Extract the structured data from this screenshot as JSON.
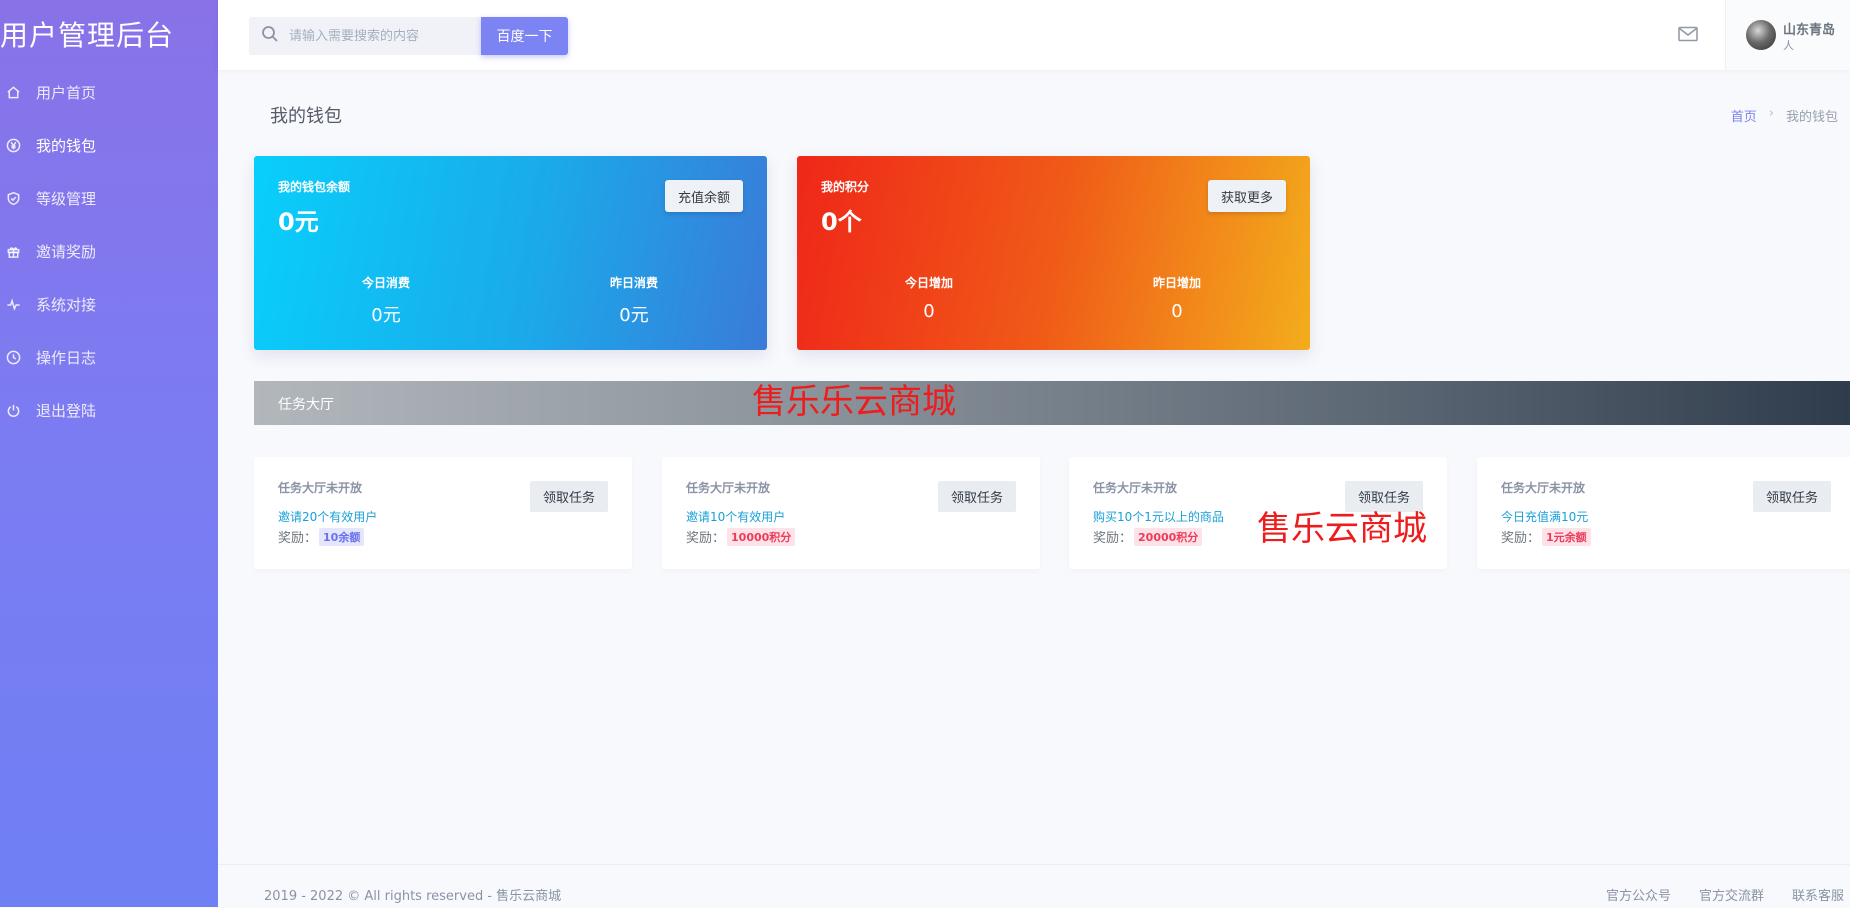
{
  "sidebar": {
    "brand": "用户管理后台",
    "items": [
      {
        "label": "用户首页",
        "icon": "home-icon"
      },
      {
        "label": "我的钱包",
        "icon": "yen-icon"
      },
      {
        "label": "等级管理",
        "icon": "shield-check-icon"
      },
      {
        "label": "邀请奖励",
        "icon": "gift-icon"
      },
      {
        "label": "系统对接",
        "icon": "pulse-icon"
      },
      {
        "label": "操作日志",
        "icon": "clock-icon"
      },
      {
        "label": "退出登陆",
        "icon": "power-icon"
      }
    ],
    "active_index": 1,
    "gradient": [
      "#8972e8",
      "#6f7ff4"
    ]
  },
  "topbar": {
    "search_placeholder": "请输入需要搜索的内容",
    "search_value": "",
    "search_button": "百度一下",
    "user_name": "山东青岛",
    "user_role": "人"
  },
  "page": {
    "title": "我的钱包",
    "breadcrumb": {
      "home": "首页",
      "separator": "›",
      "current": "我的钱包"
    }
  },
  "wallet": {
    "label": "我的钱包余额",
    "value": "0元",
    "button": "充值余额",
    "today_label": "今日消费",
    "today_value": "0元",
    "yesterday_label": "昨日消费",
    "yesterday_value": "0元"
  },
  "points": {
    "label": "我的积分",
    "value": "0个",
    "button": "获取更多",
    "today_label": "今日增加",
    "today_value": "0",
    "yesterday_label": "昨日增加",
    "yesterday_value": "0"
  },
  "task_hall": {
    "title": "任务大厅",
    "watermark": "售乐乐云商城"
  },
  "watermark2": "售乐云商城",
  "tasks": [
    {
      "status": "任务大厅未开放",
      "desc": "邀请20个有效用户",
      "reward_label": "奖励：",
      "reward": "10余额",
      "button": "领取任务"
    },
    {
      "status": "任务大厅未开放",
      "desc": "邀请10个有效用户",
      "reward_label": "奖励：",
      "reward": "10000积分",
      "button": "领取任务"
    },
    {
      "status": "任务大厅未开放",
      "desc": "购买10个1元以上的商品",
      "reward_label": "奖励：",
      "reward": "20000积分",
      "button": "领取任务"
    },
    {
      "status": "任务大厅未开放",
      "desc": "今日充值满10元",
      "reward_label": "奖励：",
      "reward": "1元余额",
      "button": "领取任务"
    }
  ],
  "footer": {
    "copyright": "2019 - 2022 © All rights reserved - 售乐云商城",
    "links": [
      "官方公众号",
      "官方交流群",
      "联系客服"
    ]
  },
  "colors": {
    "accent": "#7c83f2",
    "wallet_gradient": [
      "#08cffc",
      "#3a7bd8"
    ],
    "points_gradient": [
      "#ef2719",
      "#f3ad1c"
    ],
    "watermark": "#ee1c1c"
  }
}
